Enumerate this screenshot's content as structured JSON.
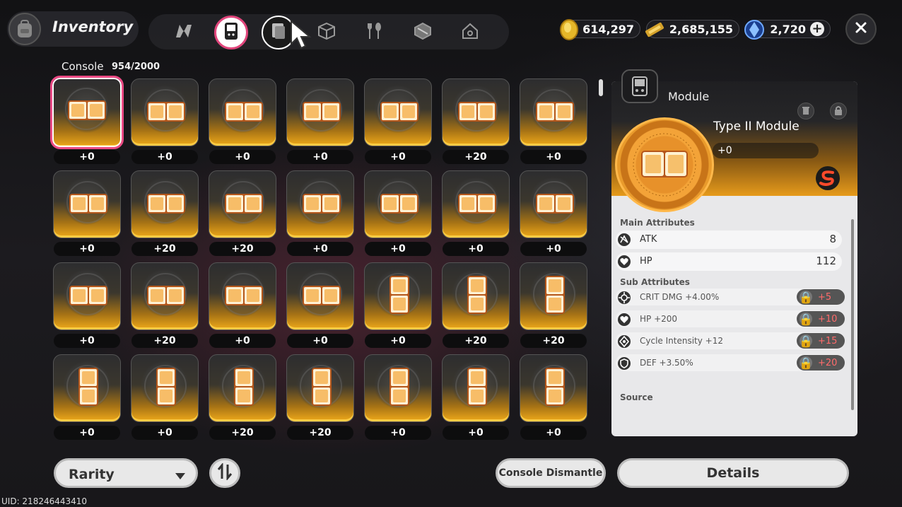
{
  "header": {
    "title": "Inventory",
    "tabs": [
      {
        "name": "tab-overview",
        "icon": "n-logo-icon"
      },
      {
        "name": "tab-console",
        "icon": "console-icon",
        "active": true
      },
      {
        "name": "tab-module",
        "icon": "module-icon"
      },
      {
        "name": "tab-box",
        "icon": "box-icon"
      },
      {
        "name": "tab-food",
        "icon": "fork-spoon-icon"
      },
      {
        "name": "tab-material",
        "icon": "cube-icon"
      },
      {
        "name": "tab-home",
        "icon": "home-icon"
      }
    ],
    "currencies": [
      {
        "icon": "gold-coin-icon",
        "value": "614,297"
      },
      {
        "icon": "ticket-icon",
        "value": "2,685,155"
      },
      {
        "icon": "crystal-icon",
        "value": "2,720"
      }
    ],
    "accent": "#e0457b"
  },
  "section": {
    "label": "Console",
    "count": "954/2000"
  },
  "grid": {
    "rows": [
      [
        {
          "shape": "h",
          "level": "+0"
        },
        {
          "shape": "h",
          "level": "+0"
        },
        {
          "shape": "h",
          "level": "+0"
        },
        {
          "shape": "h",
          "level": "+0"
        },
        {
          "shape": "h",
          "level": "+0"
        },
        {
          "shape": "h",
          "level": "+20"
        },
        {
          "shape": "h",
          "level": "+0"
        }
      ],
      [
        {
          "shape": "h",
          "level": "+0"
        },
        {
          "shape": "h",
          "level": "+20"
        },
        {
          "shape": "h",
          "level": "+20"
        },
        {
          "shape": "h",
          "level": "+0"
        },
        {
          "shape": "h",
          "level": "+0"
        },
        {
          "shape": "h",
          "level": "+0"
        },
        {
          "shape": "h",
          "level": "+0"
        }
      ],
      [
        {
          "shape": "h",
          "level": "+0"
        },
        {
          "shape": "h",
          "level": "+20"
        },
        {
          "shape": "h",
          "level": "+0"
        },
        {
          "shape": "h",
          "level": "+0"
        },
        {
          "shape": "v",
          "level": "+0"
        },
        {
          "shape": "v",
          "level": "+20"
        },
        {
          "shape": "v",
          "level": "+20"
        }
      ],
      [
        {
          "shape": "v",
          "level": "+0"
        },
        {
          "shape": "v",
          "level": "+0"
        },
        {
          "shape": "v",
          "level": "+20"
        },
        {
          "shape": "v",
          "level": "+20"
        },
        {
          "shape": "v",
          "level": "+0"
        },
        {
          "shape": "v",
          "level": "+0"
        },
        {
          "shape": "v",
          "level": "+0"
        }
      ]
    ]
  },
  "detail": {
    "category": "Module",
    "name": "Type II Module",
    "level": "+0",
    "main_title": "Main Attributes",
    "main": [
      {
        "icon": "atk-icon",
        "name": "ATK",
        "value": "8"
      },
      {
        "icon": "hp-icon",
        "name": "HP",
        "value": "112"
      }
    ],
    "sub_title": "Sub Attributes",
    "sub": [
      {
        "icon": "crit-icon",
        "name": "CRIT DMG +4.00%",
        "bonus": "+5"
      },
      {
        "icon": "hp-icon",
        "name": "HP +200",
        "bonus": "+10"
      },
      {
        "icon": "cycle-icon",
        "name": "Cycle Intensity +12",
        "bonus": "+15"
      },
      {
        "icon": "def-icon",
        "name": "DEF +3.50%",
        "bonus": "+20"
      }
    ],
    "source_title": "Source"
  },
  "footer": {
    "rarity_label": "Rarity",
    "dismantle_label": "Console Dismantle",
    "details_label": "Details",
    "uid": "UID: 218246443410"
  }
}
